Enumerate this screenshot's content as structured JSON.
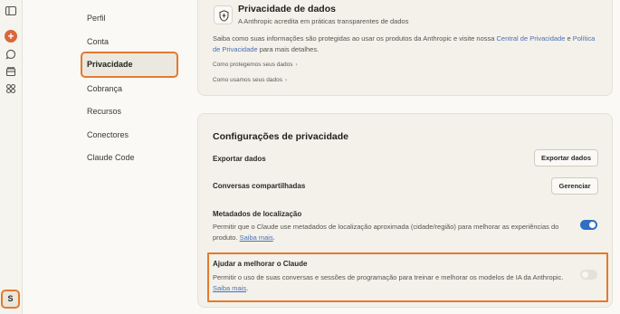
{
  "rail": {
    "icons": [
      "sidebar-toggle-icon",
      "new-chat-icon",
      "chats-icon",
      "projects-icon",
      "artifacts-icon"
    ],
    "new_chat_glyph": "+",
    "avatar_initial": "S"
  },
  "nav": {
    "items": [
      {
        "label": "Perfil"
      },
      {
        "label": "Conta"
      },
      {
        "label": "Privacidade"
      },
      {
        "label": "Cobrança"
      },
      {
        "label": "Recursos"
      },
      {
        "label": "Conectores"
      },
      {
        "label": "Claude Code"
      }
    ],
    "active": "Privacidade"
  },
  "data_privacy": {
    "title": "Privacidade de dados",
    "subtitle": "A Anthropic acredita em práticas transparentes de dados",
    "desc_prefix": "Saiba como suas informações são protegidas ao usar os produtos da Anthropic e visite nossa ",
    "link_privacy_center": "Central de Privacidade",
    "desc_and": " e ",
    "link_privacy_policy": "Política de Privacidade",
    "desc_suffix": " para mais detalhes.",
    "how_protect": "Como protegemos seus dados",
    "how_use": "Como usamos seus dados"
  },
  "privacy_settings": {
    "title": "Configurações de privacidade",
    "export_label": "Exportar dados",
    "export_button": "Exportar dados",
    "shared_label": "Conversas compartilhadas",
    "manage_button": "Gerenciar",
    "location_label": "Metadados de localização",
    "location_desc": "Permitir que o Claude use metadados de localização aproximada (cidade/região) para melhorar as experiências do produto. ",
    "location_learn_more": "Saiba mais",
    "location_enabled": true,
    "improve_label": "Ajudar a melhorar o Claude",
    "improve_desc": "Permitir o uso de suas conversas e sessões de programação para treinar e melhorar os modelos de IA da Anthropic. ",
    "improve_learn_more": "Saiba mais",
    "improve_enabled": false,
    "period": "."
  },
  "colors": {
    "accent_link": "#4a6fb5",
    "toggle_on": "#2f6fc4",
    "highlight": "#e47a2d",
    "new_chat": "#d9673c"
  }
}
